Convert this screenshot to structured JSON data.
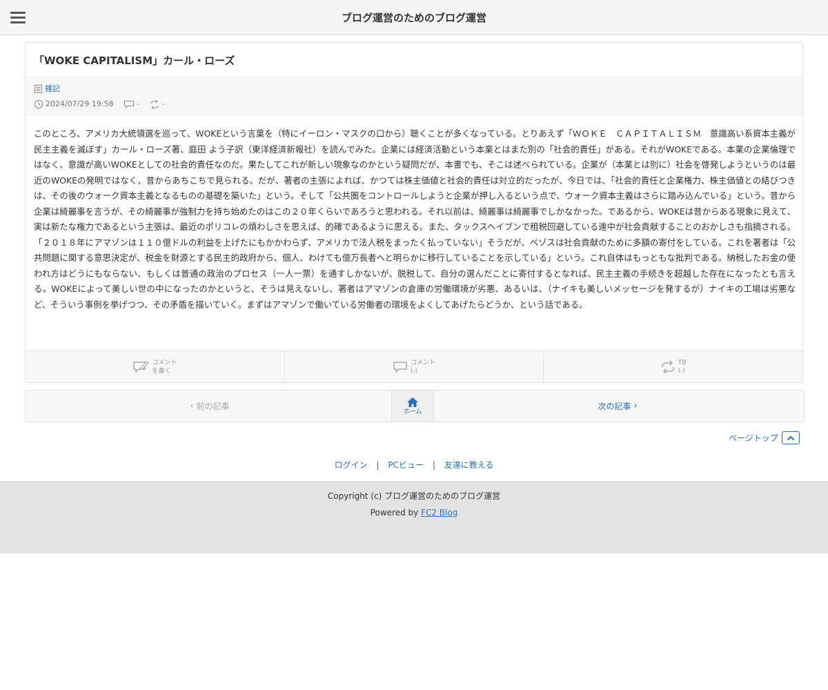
{
  "header": {
    "menu_icon": "hamburger-menu-icon",
    "site_title": "ブログ運営のためのブログ運営"
  },
  "entry": {
    "title": "「WOKE CAPITALISM」カール・ローズ",
    "category": "雑記",
    "datetime": "2024/07/29 19:58",
    "comment_count": "-",
    "trackback_count": "-",
    "body": "このところ、アメリカ大統領選を巡って、WOKEという言葉を（特にイーロン・マスクの口から）聴くことが多くなっている。とりあえず「ＷＯＫＥ　ＣＡＰＩＴＡＬＩＳＭ　意識高い系資本主義が民主主義を滅ぼす」カール・ローズ著、庭田 よう子訳（東洋経済新報社）を読んでみた。企業には経済活動という本業とはまた別の「社会的責任」がある。それがWOKEである。本業の企業倫理ではなく、意識が高いWOKEとしての社会的責任なのだ。果たしてこれが新しい現象なのかという疑問だが、本書でも、そこは述べられている。企業が（本業とは別に）社会を啓発しようというのは最近のWOKEの発明ではなく、昔からあちこちで見られる。だが、著者の主張によれば、かつては株主価値と社会的責任は対立的だったが、今日では、「社会的責任と企業権力、株主価値との結びつきは、その後のウォーク資本主義となるものの基礎を築いた」という。そして「公共圏をコントロールしようと企業が押し入るという点で、ウォーク資本主義はさらに踏み込んでいる」という。昔から企業は綺麗事を言うが、その綺麗事が強制力を持ち始めたのはこの２０年くらいであろうと思われる。それ以前は、綺麗事は綺麗事でしかなかった。であるから、WOKEは昔からある現象に見えて、実は新たな権力であるという主張は、最近のポリコレの煩わしさを思えば、的確であるように思える。また、タックスヘイブンで租税回避している連中が社会貢献することのおかしさも指摘される。「２０１８年にアマゾンは１１０億ドルの利益を上げたにもかかわらず、アメリカで法人税をまったく払っていない」そうだが、ベゾスは社会貢献のために多額の寄付をしている。これを著者は「公共問題に関する意思決定が、税金を財源とする民主的政府から、個人、わけても億万長者へと明らかに移行していることを示している」という。これ自体はもっともな批判である。納税したお金の使われ方はどうにもならない、もしくは普通の政治のプロセス（一人一票）を通すしかないが、脱税して、自分の選んだことに寄付するとなれば、民主主義の手続きを超越した存在になったとも言える。WOKEによって美しい世の中になったのかというと、そうは見えないし、著者はアマゾンの倉庫の労働環境が劣悪、あるいは、（ナイキも美しいメッセージを発するが）ナイキの工場は劣悪など、そういう事例を挙げつつ、その矛盾を描いていく。まずはアマゾンで働いている労働者の環境をよくしてあげたらどうか、という話である。"
  },
  "entry_footer": {
    "write_comment": {
      "line1": "コメント",
      "line2": "を書く",
      "icon": "write-comment-icon"
    },
    "comments": {
      "line1": "コメント",
      "line2": "(-)",
      "icon": "comment-bubble-icon"
    },
    "trackback": {
      "line1": "TB",
      "line2": "(-)",
      "icon": "trackback-arrows-icon"
    }
  },
  "pager": {
    "prev_label": "前の記事",
    "home_label": "ホーム",
    "next_label": "次の記事",
    "prev_chevron": "‹",
    "next_chevron": "›"
  },
  "pagetop": {
    "label": "ページトップ"
  },
  "links": {
    "login": "ログイン",
    "pc_view": "PCビュー",
    "tell_friend": "友達に教える",
    "separator": "|"
  },
  "footer": {
    "copyright": "Copyright (c) ブログ運営のためのブログ運営",
    "powered_prefix": "Powered by ",
    "powered_link": "FC2 Blog"
  },
  "colors": {
    "link": "#2a6fb5",
    "text": "#333333",
    "footer_bg": "#e3e3e3"
  }
}
